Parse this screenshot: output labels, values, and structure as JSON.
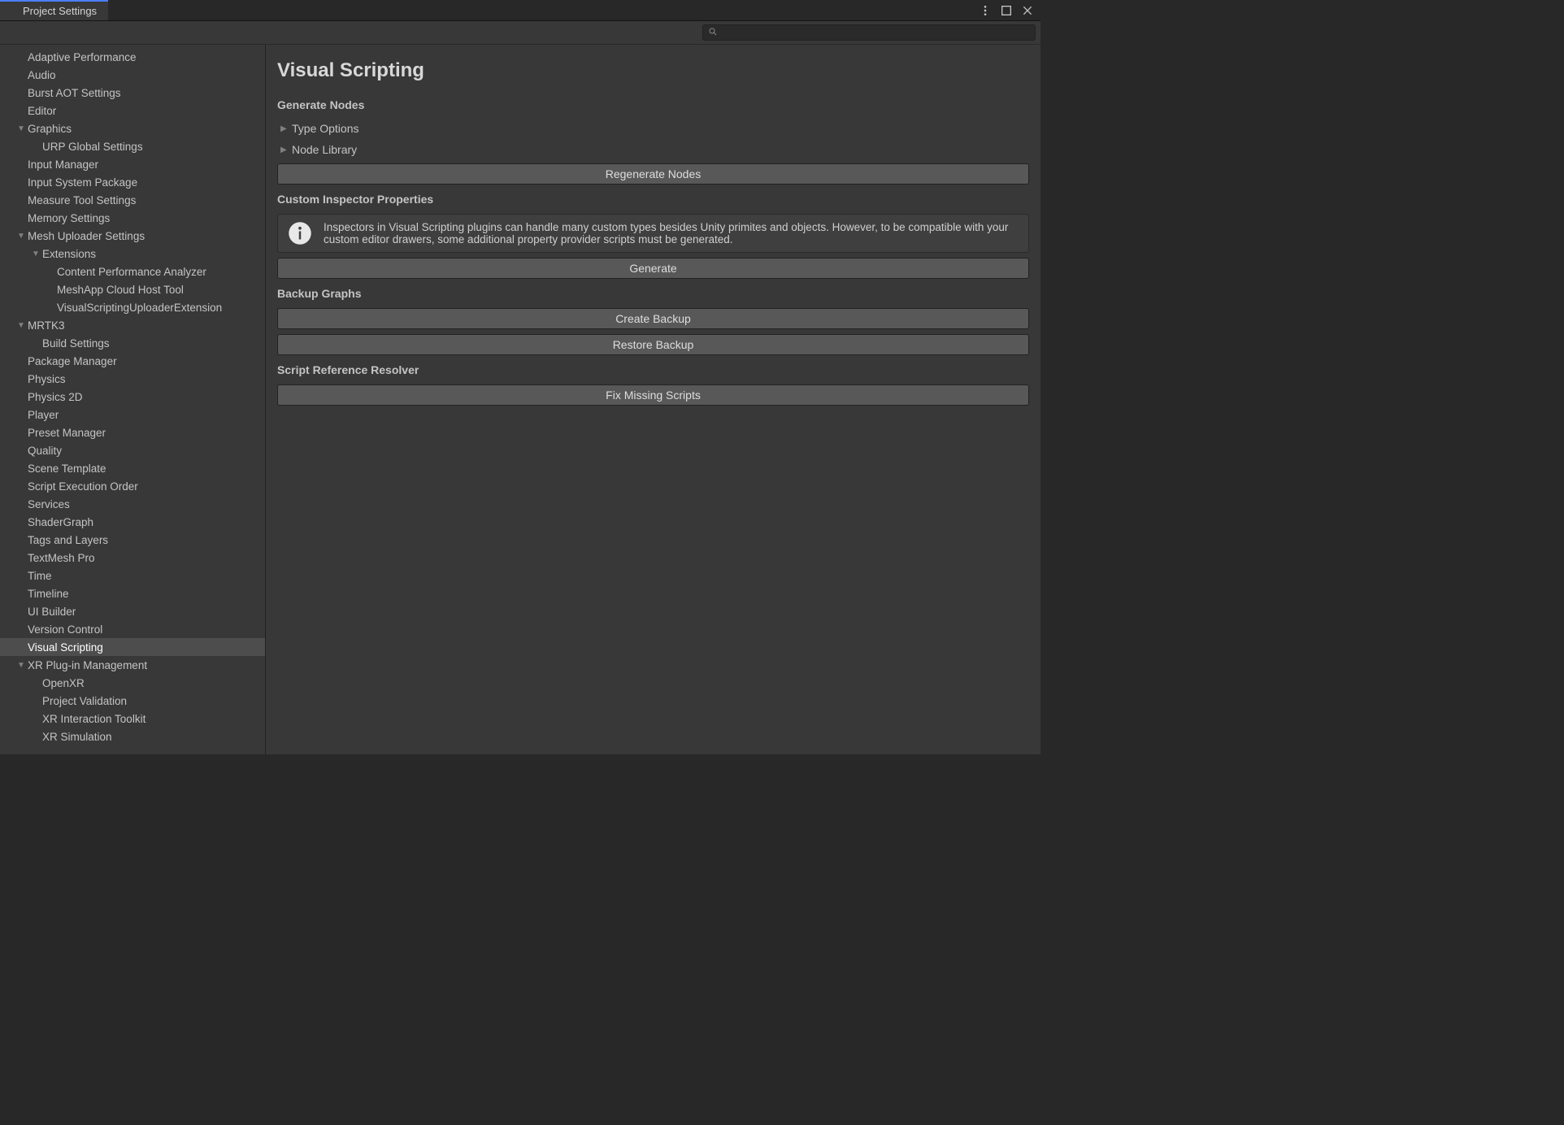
{
  "tab_title": "Project Settings",
  "search": {
    "value": "",
    "placeholder": ""
  },
  "sidebar": {
    "items": [
      {
        "label": "Adaptive Performance",
        "indent": 0,
        "arrow": "none",
        "selected": false
      },
      {
        "label": "Audio",
        "indent": 0,
        "arrow": "none",
        "selected": false
      },
      {
        "label": "Burst AOT Settings",
        "indent": 0,
        "arrow": "none",
        "selected": false
      },
      {
        "label": "Editor",
        "indent": 0,
        "arrow": "none",
        "selected": false
      },
      {
        "label": "Graphics",
        "indent": 0,
        "arrow": "down",
        "selected": false
      },
      {
        "label": "URP Global Settings",
        "indent": 1,
        "arrow": "none",
        "selected": false
      },
      {
        "label": "Input Manager",
        "indent": 0,
        "arrow": "none",
        "selected": false
      },
      {
        "label": "Input System Package",
        "indent": 0,
        "arrow": "none",
        "selected": false
      },
      {
        "label": "Measure Tool Settings",
        "indent": 0,
        "arrow": "none",
        "selected": false
      },
      {
        "label": "Memory Settings",
        "indent": 0,
        "arrow": "none",
        "selected": false
      },
      {
        "label": "Mesh Uploader Settings",
        "indent": 0,
        "arrow": "down",
        "selected": false
      },
      {
        "label": "Extensions",
        "indent": 1,
        "arrow": "down",
        "selected": false
      },
      {
        "label": "Content Performance Analyzer",
        "indent": 2,
        "arrow": "none",
        "selected": false
      },
      {
        "label": "MeshApp Cloud Host Tool",
        "indent": 2,
        "arrow": "none",
        "selected": false
      },
      {
        "label": "VisualScriptingUploaderExtension",
        "indent": 2,
        "arrow": "none",
        "selected": false
      },
      {
        "label": "MRTK3",
        "indent": 0,
        "arrow": "down",
        "selected": false
      },
      {
        "label": "Build Settings",
        "indent": 1,
        "arrow": "none",
        "selected": false
      },
      {
        "label": "Package Manager",
        "indent": 0,
        "arrow": "none",
        "selected": false
      },
      {
        "label": "Physics",
        "indent": 0,
        "arrow": "none",
        "selected": false
      },
      {
        "label": "Physics 2D",
        "indent": 0,
        "arrow": "none",
        "selected": false
      },
      {
        "label": "Player",
        "indent": 0,
        "arrow": "none",
        "selected": false
      },
      {
        "label": "Preset Manager",
        "indent": 0,
        "arrow": "none",
        "selected": false
      },
      {
        "label": "Quality",
        "indent": 0,
        "arrow": "none",
        "selected": false
      },
      {
        "label": "Scene Template",
        "indent": 0,
        "arrow": "none",
        "selected": false
      },
      {
        "label": "Script Execution Order",
        "indent": 0,
        "arrow": "none",
        "selected": false
      },
      {
        "label": "Services",
        "indent": 0,
        "arrow": "none",
        "selected": false
      },
      {
        "label": "ShaderGraph",
        "indent": 0,
        "arrow": "none",
        "selected": false
      },
      {
        "label": "Tags and Layers",
        "indent": 0,
        "arrow": "none",
        "selected": false
      },
      {
        "label": "TextMesh Pro",
        "indent": 0,
        "arrow": "none",
        "selected": false
      },
      {
        "label": "Time",
        "indent": 0,
        "arrow": "none",
        "selected": false
      },
      {
        "label": "Timeline",
        "indent": 0,
        "arrow": "none",
        "selected": false
      },
      {
        "label": "UI Builder",
        "indent": 0,
        "arrow": "none",
        "selected": false
      },
      {
        "label": "Version Control",
        "indent": 0,
        "arrow": "none",
        "selected": false
      },
      {
        "label": "Visual Scripting",
        "indent": 0,
        "arrow": "none",
        "selected": true
      },
      {
        "label": "XR Plug-in Management",
        "indent": 0,
        "arrow": "down",
        "selected": false
      },
      {
        "label": "OpenXR",
        "indent": 1,
        "arrow": "none",
        "selected": false
      },
      {
        "label": "Project Validation",
        "indent": 1,
        "arrow": "none",
        "selected": false
      },
      {
        "label": "XR Interaction Toolkit",
        "indent": 1,
        "arrow": "none",
        "selected": false
      },
      {
        "label": "XR Simulation",
        "indent": 1,
        "arrow": "none",
        "selected": false
      }
    ]
  },
  "main": {
    "title": "Visual Scripting",
    "sections": {
      "generate_nodes": {
        "heading": "Generate Nodes",
        "foldouts": [
          "Type Options",
          "Node Library"
        ],
        "button": "Regenerate Nodes"
      },
      "custom_inspector": {
        "heading": "Custom Inspector Properties",
        "info": "Inspectors in Visual Scripting plugins can handle many custom types besides Unity primites and objects. However, to be compatible with your custom editor drawers, some additional property provider scripts must be generated.",
        "button": "Generate"
      },
      "backup_graphs": {
        "heading": "Backup Graphs",
        "button_create": "Create Backup",
        "button_restore": "Restore Backup"
      },
      "script_resolver": {
        "heading": "Script Reference Resolver",
        "button": "Fix Missing Scripts"
      }
    }
  }
}
